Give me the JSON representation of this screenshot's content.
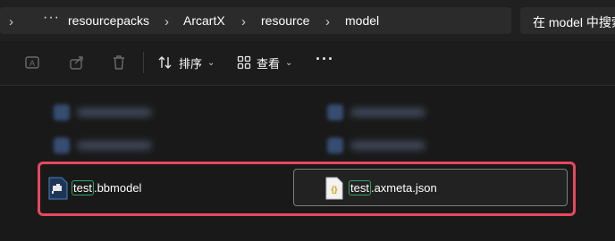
{
  "address_bar": {
    "breadcrumbs": [
      "resourcepacks",
      "ArcartX",
      "resource",
      "model"
    ],
    "more": "···",
    "search_placeholder": "在 model 中搜索"
  },
  "toolbar": {
    "sort_label": "排序",
    "view_label": "查看",
    "more": "···"
  },
  "files": [
    {
      "name_highlight": "test",
      "name_rest": ".bbmodel",
      "icon": "blockbench-file-icon"
    },
    {
      "name_highlight": "test",
      "name_rest": ".axmeta.json",
      "icon": "json-file-icon"
    }
  ],
  "colors": {
    "background": "#191919",
    "highlight_border": "#e8485e",
    "match_border": "#2fa866",
    "selected_border": "#7d7d7d"
  }
}
